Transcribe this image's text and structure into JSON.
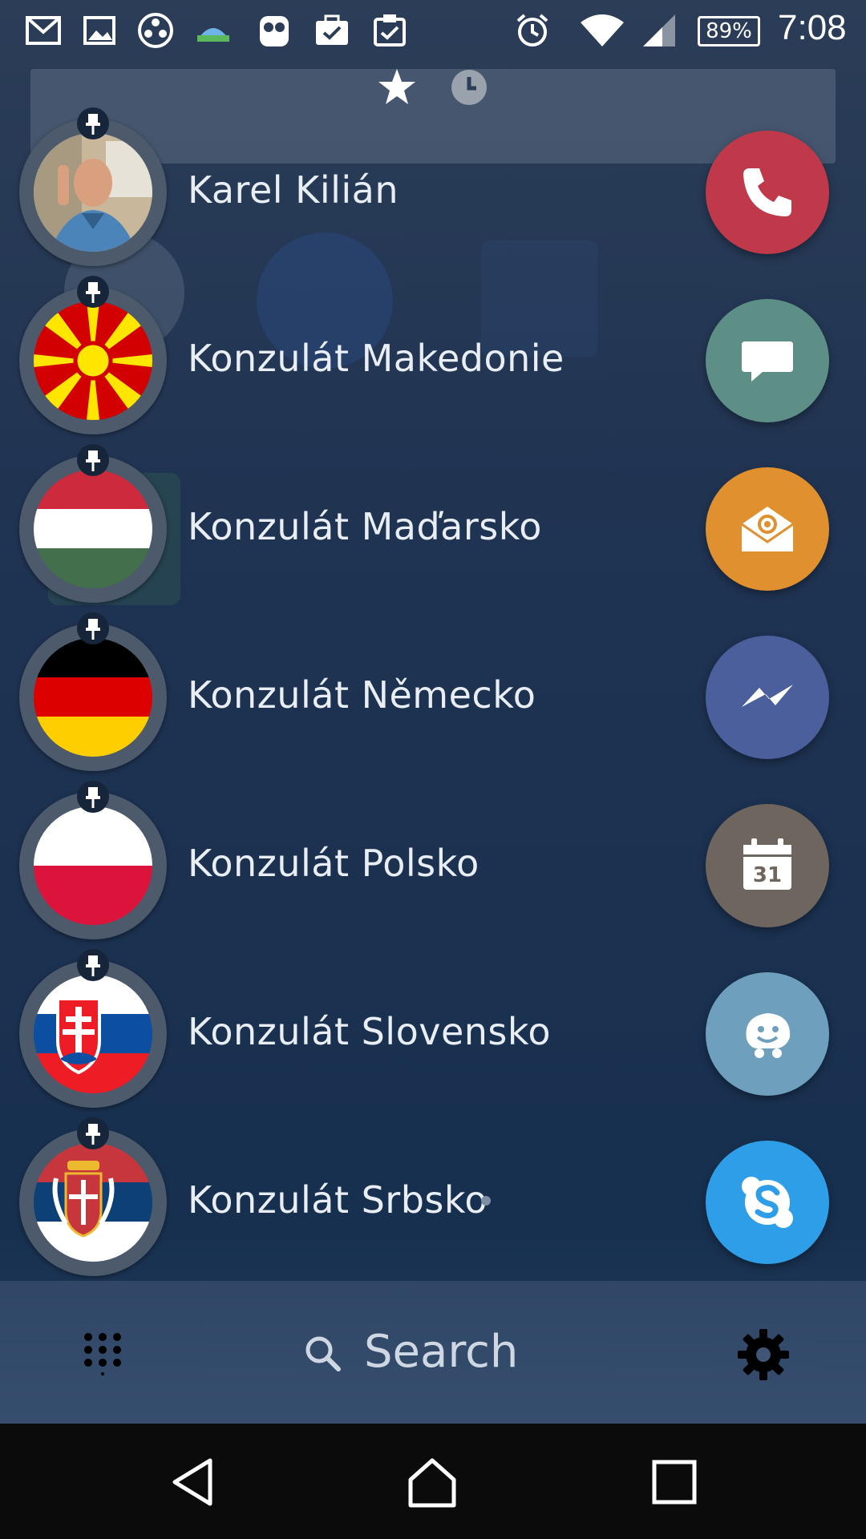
{
  "status_bar": {
    "battery": "89%",
    "time": "7:08",
    "left_icons": [
      "gmail-icon",
      "gallery-icon",
      "reel-icon",
      "maps-icon",
      "owl-icon",
      "briefcase-check-icon",
      "clipboard-check-icon"
    ],
    "right_icons": [
      "alarm-icon",
      "wifi-icon",
      "signal-icon",
      "battery-icon"
    ]
  },
  "tabs": [
    {
      "icon": "star-icon",
      "active": true
    },
    {
      "icon": "clock-icon",
      "active": false
    }
  ],
  "contacts": [
    {
      "name": "Karel Kilián",
      "avatar": "photo"
    },
    {
      "name": "Konzulát Makedonie",
      "avatar": "flag-macedonia"
    },
    {
      "name": "Konzulát Maďarsko",
      "avatar": "flag-hungary"
    },
    {
      "name": "Konzulát Německo",
      "avatar": "flag-germany"
    },
    {
      "name": "Konzulát Polsko",
      "avatar": "flag-poland"
    },
    {
      "name": "Konzulát Slovensko",
      "avatar": "flag-slovakia"
    },
    {
      "name": "Konzulát Srbsko",
      "avatar": "flag-serbia"
    }
  ],
  "actions": [
    {
      "icon": "phone-icon",
      "color": "#c0394a"
    },
    {
      "icon": "message-icon",
      "color": "#5e8f86"
    },
    {
      "icon": "email-icon",
      "color": "#e0902f"
    },
    {
      "icon": "messenger-icon",
      "color": "#4c5f9d"
    },
    {
      "icon": "calendar-icon",
      "color": "#6f655f",
      "label": "31"
    },
    {
      "icon": "waze-icon",
      "color": "#6ea0be"
    },
    {
      "icon": "skype-icon",
      "color": "#2f9ee8"
    }
  ],
  "search": {
    "label": "Search"
  },
  "nav": [
    "back-icon",
    "home-icon",
    "recents-icon"
  ]
}
